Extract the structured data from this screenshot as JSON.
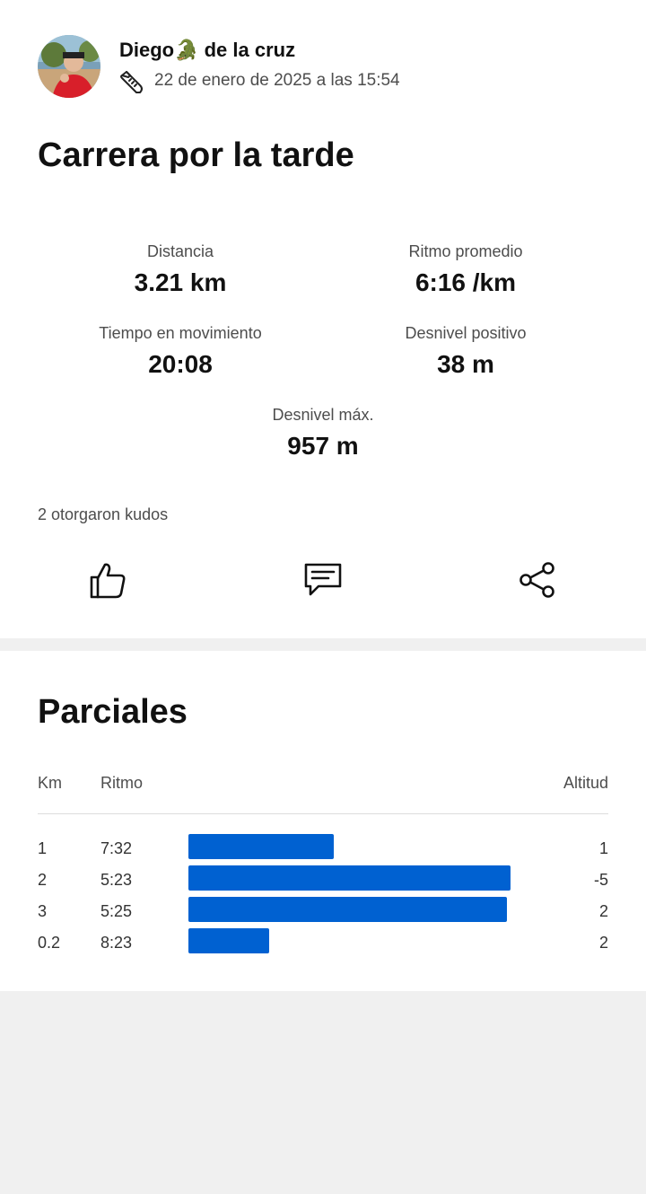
{
  "athlete": {
    "name": "Diego🐊 de la cruz",
    "date": "22 de enero de 2025 a las 15:54",
    "activity_icon": "running-shoe-icon"
  },
  "activity": {
    "title": "Carrera por la tarde"
  },
  "stats": {
    "distance": {
      "label": "Distancia",
      "value": "3.21 km"
    },
    "pace": {
      "label": "Ritmo promedio",
      "value": "6:16 /km"
    },
    "moving_time": {
      "label": "Tiempo en movimiento",
      "value": "20:08"
    },
    "elevation_gain": {
      "label": "Desnivel positivo",
      "value": "38 m"
    },
    "max_elevation": {
      "label": "Desnivel máx.",
      "value": "957 m"
    }
  },
  "kudos": {
    "text": "2 otorgaron kudos"
  },
  "actions": {
    "kudos_icon": "thumbs-up-icon",
    "comment_icon": "comment-icon",
    "share_icon": "share-icon"
  },
  "splits": {
    "title": "Parciales",
    "headers": {
      "km": "Km",
      "pace": "Ritmo",
      "altitude": "Altitud"
    },
    "bar_color": "#0061d1",
    "rows": [
      {
        "km": "1",
        "pace": "7:32",
        "altitude": "1",
        "speed_fraction": 0.45
      },
      {
        "km": "2",
        "pace": "5:23",
        "altitude": "-5",
        "speed_fraction": 1.0
      },
      {
        "km": "3",
        "pace": "5:25",
        "altitude": "2",
        "speed_fraction": 0.99
      },
      {
        "km": "0.2",
        "pace": "8:23",
        "altitude": "2",
        "speed_fraction": 0.25
      }
    ]
  }
}
